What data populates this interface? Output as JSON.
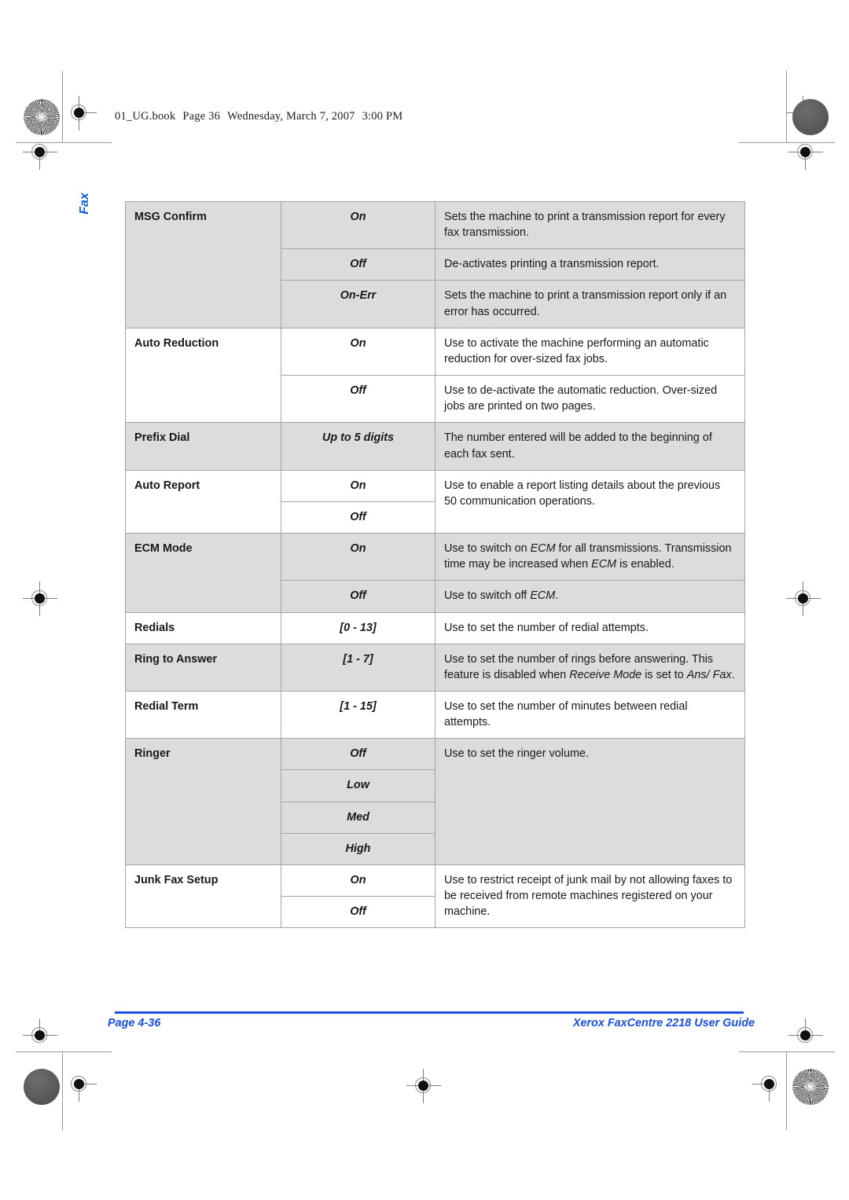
{
  "page": {
    "running_header": {
      "file": "01_UG.book",
      "page_marker": "Page 36",
      "date": "Wednesday, March 7, 2007",
      "time": "3:00 PM"
    },
    "side_tab": "Fax",
    "footer": {
      "page_number": "Page 4-36",
      "guide_title": "Xerox FaxCentre 2218 User Guide"
    },
    "accent_color": "#1a4fe0",
    "heading_color": "#0f5ae0",
    "shaded_row_color": "#dcdcdc"
  },
  "table": {
    "rows": [
      {
        "feature": "MSG Confirm",
        "shaded": true,
        "entries": [
          {
            "option": "On",
            "desc": "Sets the machine to print a transmission report for every fax transmission."
          },
          {
            "option": "Off",
            "desc": "De-activates printing a transmission report."
          },
          {
            "option": "On-Err",
            "desc": "Sets the machine to print a transmission report only if an error has occurred."
          }
        ]
      },
      {
        "feature": "Auto Reduction",
        "shaded": false,
        "entries": [
          {
            "option": "On",
            "desc": "Use to activate the machine performing an automatic reduction for over-sized fax jobs."
          },
          {
            "option": "Off",
            "desc": "Use to de-activate the automatic reduction. Over-sized jobs are printed on two pages."
          }
        ]
      },
      {
        "feature": "Prefix Dial",
        "shaded": true,
        "entries": [
          {
            "option": "Up to 5 digits",
            "desc": "The number entered will be added to the beginning of each fax sent."
          }
        ]
      },
      {
        "feature": "Auto Report",
        "shaded": false,
        "shared_desc": "Use to enable a report listing details about the previous 50 communication operations.",
        "entries": [
          {
            "option": "On"
          },
          {
            "option": "Off"
          }
        ]
      },
      {
        "feature": "ECM Mode",
        "shaded": true,
        "entries": [
          {
            "option": "On",
            "desc_html": "Use to switch on <em>ECM</em> for all transmissions. Transmission time may be increased when <em>ECM</em> is enabled."
          },
          {
            "option": "Off",
            "desc_html": "Use to switch off <em>ECM</em>."
          }
        ]
      },
      {
        "feature": "Redials",
        "shaded": false,
        "entries": [
          {
            "option": "[0 - 13]",
            "desc": "Use to set the number of redial attempts."
          }
        ]
      },
      {
        "feature": "Ring to Answer",
        "shaded": true,
        "entries": [
          {
            "option": "[1 - 7]",
            "desc_html": "Use to set the number of rings before answering. This feature is disabled when <em>Receive Mode</em> is set to <em>Ans/ Fax</em>."
          }
        ]
      },
      {
        "feature": "Redial Term",
        "shaded": false,
        "entries": [
          {
            "option": "[1 - 15]",
            "desc": "Use to set the number of minutes between redial attempts."
          }
        ]
      },
      {
        "feature": "Ringer",
        "shaded": true,
        "shared_desc": "Use to set the ringer volume.",
        "entries": [
          {
            "option": "Off"
          },
          {
            "option": "Low"
          },
          {
            "option": "Med"
          },
          {
            "option": "High"
          }
        ]
      },
      {
        "feature": "Junk Fax Setup",
        "shaded": false,
        "shared_desc": "Use to restrict receipt of junk mail by not allowing faxes to be received from remote machines registered on your machine.",
        "entries": [
          {
            "option": "On"
          },
          {
            "option": "Off"
          }
        ]
      }
    ]
  },
  "print_marks": {
    "registration_icon": "registration-target-icon",
    "density_patch_icon": "density-patch-icon",
    "moire_star_icon": "moire-star-target-icon"
  }
}
